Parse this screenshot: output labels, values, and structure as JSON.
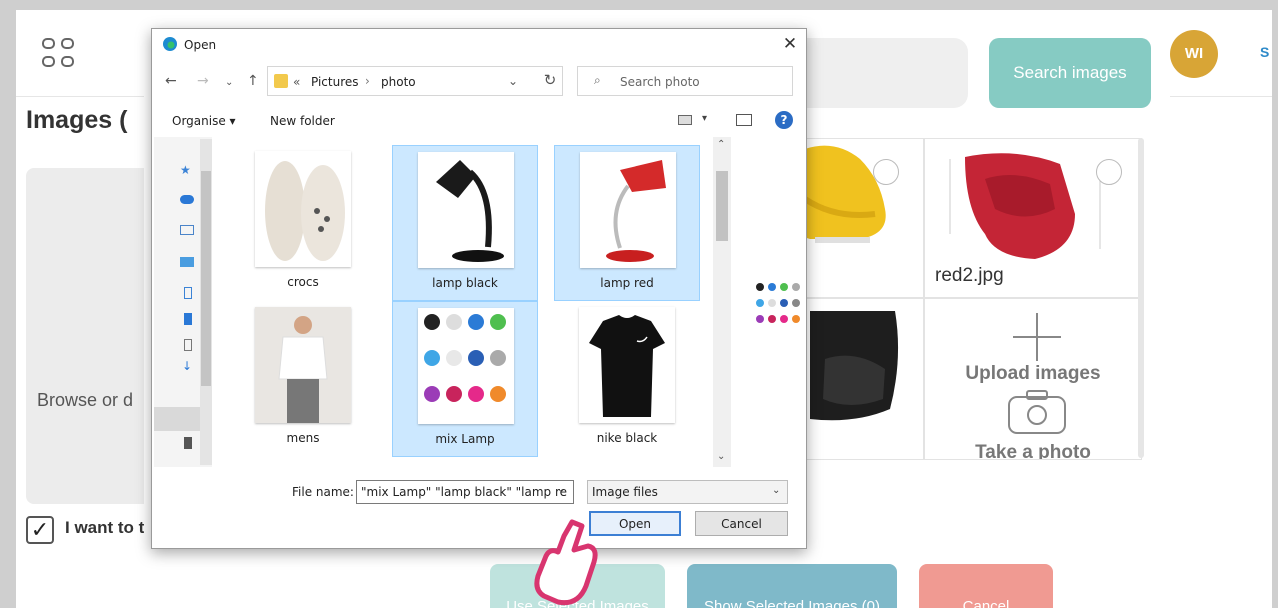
{
  "app": {
    "page_title": "Images (",
    "avatar_initials": "WI",
    "nav_partial": "S",
    "drop_text": "Browse or d",
    "consent_text": "I want to t",
    "consent_checked": true,
    "accent_color": "#86cbc3"
  },
  "modal": {
    "search_button": "Search images",
    "tiles": [
      {
        "name": "",
        "kind": "yellow-chair"
      },
      {
        "name": "red2.jpg",
        "kind": "red-chair"
      },
      {
        "name": "",
        "kind": "black-chair"
      },
      {
        "upload_label": "Upload images",
        "photo_label": "Take a photo"
      }
    ],
    "footer_buttons": [
      {
        "label": "Use Selected Images",
        "color": "#bfe3de"
      },
      {
        "label": "Show Selected Images (0)",
        "color": "#7fb9c9"
      },
      {
        "label": "Cancel",
        "color": "#f09a92"
      }
    ]
  },
  "dialog": {
    "title": "Open",
    "breadcrumb": [
      "«",
      "Pictures",
      "›",
      "photo"
    ],
    "search_placeholder": "Search photo",
    "organise_label": "Organise ▾",
    "new_folder_label": "New folder",
    "files": [
      {
        "name": "crocs",
        "selected": false,
        "icon": "crocs-thumbnail"
      },
      {
        "name": "lamp black",
        "selected": true,
        "icon": "lamp-black-thumbnail"
      },
      {
        "name": "lamp red",
        "selected": true,
        "icon": "lamp-red-thumbnail"
      },
      {
        "name": "mens",
        "selected": false,
        "icon": "mens-thumbnail"
      },
      {
        "name": "mix Lamp",
        "selected": true,
        "icon": "mix-lamp-thumbnail"
      },
      {
        "name": "nike black",
        "selected": false,
        "icon": "nike-black-thumbnail"
      }
    ],
    "file_name_label": "File name:",
    "file_name_value": "\"mix Lamp\" \"lamp black\" \"lamp re",
    "file_type_value": "Image files",
    "open_button": "Open",
    "cancel_button": "Cancel"
  }
}
